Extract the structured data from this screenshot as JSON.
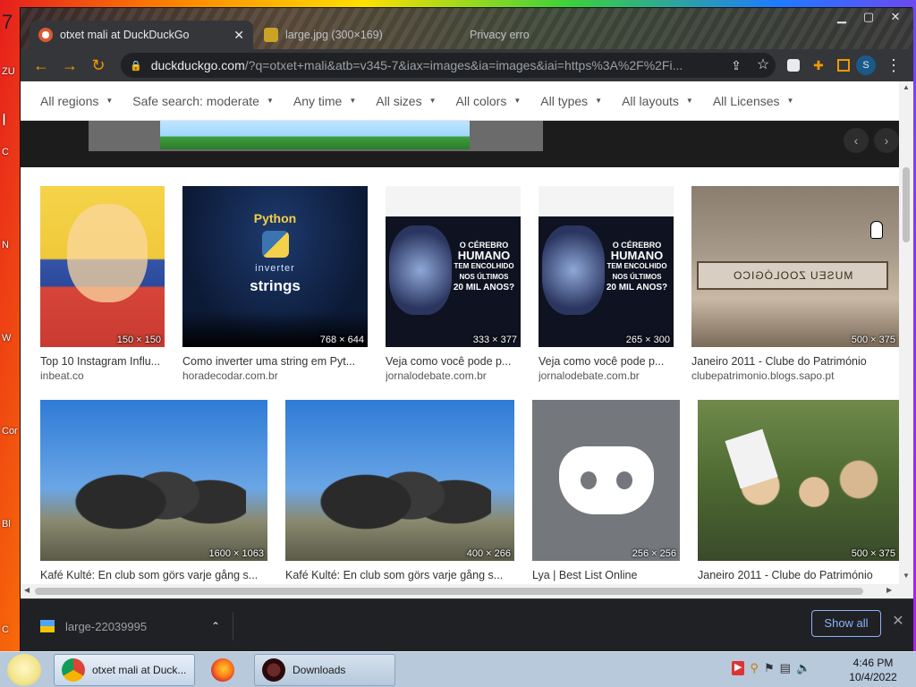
{
  "desktop": {
    "edge_labels": [
      "7",
      "ZU",
      "I",
      "C",
      "N",
      "W",
      "Cor",
      "Bl",
      "C"
    ]
  },
  "browser": {
    "tabs": [
      {
        "title": "otxet mali at DuckDuckGo",
        "active": true
      },
      {
        "title": "large.jpg (300×169)",
        "active": false
      },
      {
        "title": "Privacy erro",
        "active": false
      }
    ],
    "window_controls": {
      "minimize": "▁",
      "maximize": "▢",
      "close": "✕"
    },
    "toolbar": {
      "back": "←",
      "forward": "→",
      "reload": "↻",
      "url_host": "duckduckgo.com",
      "url_path": "/?q=otxet+mali&atb=v345-7&iax=images&ia=images&iai=https%3A%2F%2Fi...",
      "share_icon": "⇪",
      "star_icon": "☆",
      "profile_initial": "S",
      "menu_icon": "⋮"
    }
  },
  "page": {
    "filters": [
      "All regions",
      "Safe search: moderate",
      "Any time",
      "All sizes",
      "All colors",
      "All types",
      "All layouts",
      "All Licenses"
    ],
    "detail_nav": {
      "prev": "‹",
      "next": "›"
    },
    "results": [
      {
        "title": "Top 10 Instagram Influ...",
        "source": "inbeat.co",
        "dims": "150 × 150"
      },
      {
        "title": "Como inverter uma string em Pyt...",
        "source": "horadecodar.com.br",
        "dims": "768 × 644",
        "img_text": [
          "Python",
          "inverter",
          "strings"
        ]
      },
      {
        "title": "Veja como você pode p...",
        "source": "jornalodebate.com.br",
        "dims": "333 × 377",
        "img_text": [
          "O CÉREBRO",
          "HUMANO",
          "TEM ENCOLHIDO",
          "NOS ÚLTIMOS",
          "20 MIL ANOS?"
        ]
      },
      {
        "title": "Veja como você pode p...",
        "source": "jornalodebate.com.br",
        "dims": "265 × 300",
        "img_text": [
          "O CÉREBRO",
          "HUMANO",
          "TEM ENCOLHIDO",
          "NOS ÚLTIMOS",
          "20 MIL ANOS?"
        ]
      },
      {
        "title": "Janeiro 2011 - Clube do Património",
        "source": "clubepatrimonio.blogs.sapo.pt",
        "dims": "500 × 375",
        "img_text": [
          "MUSEU ZOOLÓGICO"
        ]
      },
      {
        "title": "Kafé Kulté: En club som görs varje gång s...",
        "dims": "1600 × 1063"
      },
      {
        "title": "Kafé Kulté: En club som görs varje gång s...",
        "dims": "400 × 266"
      },
      {
        "title": "Lya | Best List Online",
        "dims": "256 × 256"
      },
      {
        "title": "Janeiro 2011 - Clube do Património",
        "dims": "500 × 375"
      }
    ]
  },
  "download_bar": {
    "file_name": "large-22039995",
    "show_all_label": "Show all",
    "close_icon": "✕"
  },
  "taskbar": {
    "tasks": [
      {
        "label": "otxet mali at Duck...",
        "icon": "chrome-icon"
      },
      {
        "label": "",
        "icon": "firefox-icon"
      },
      {
        "label": "Downloads",
        "icon": "downloads-icon"
      }
    ],
    "clock_time": "4:46 PM",
    "clock_date": "10/4/2022"
  },
  "colors": {
    "accent_orange": "#f29900",
    "link_blue": "#8ab4f8",
    "chrome_dark": "#202124"
  }
}
